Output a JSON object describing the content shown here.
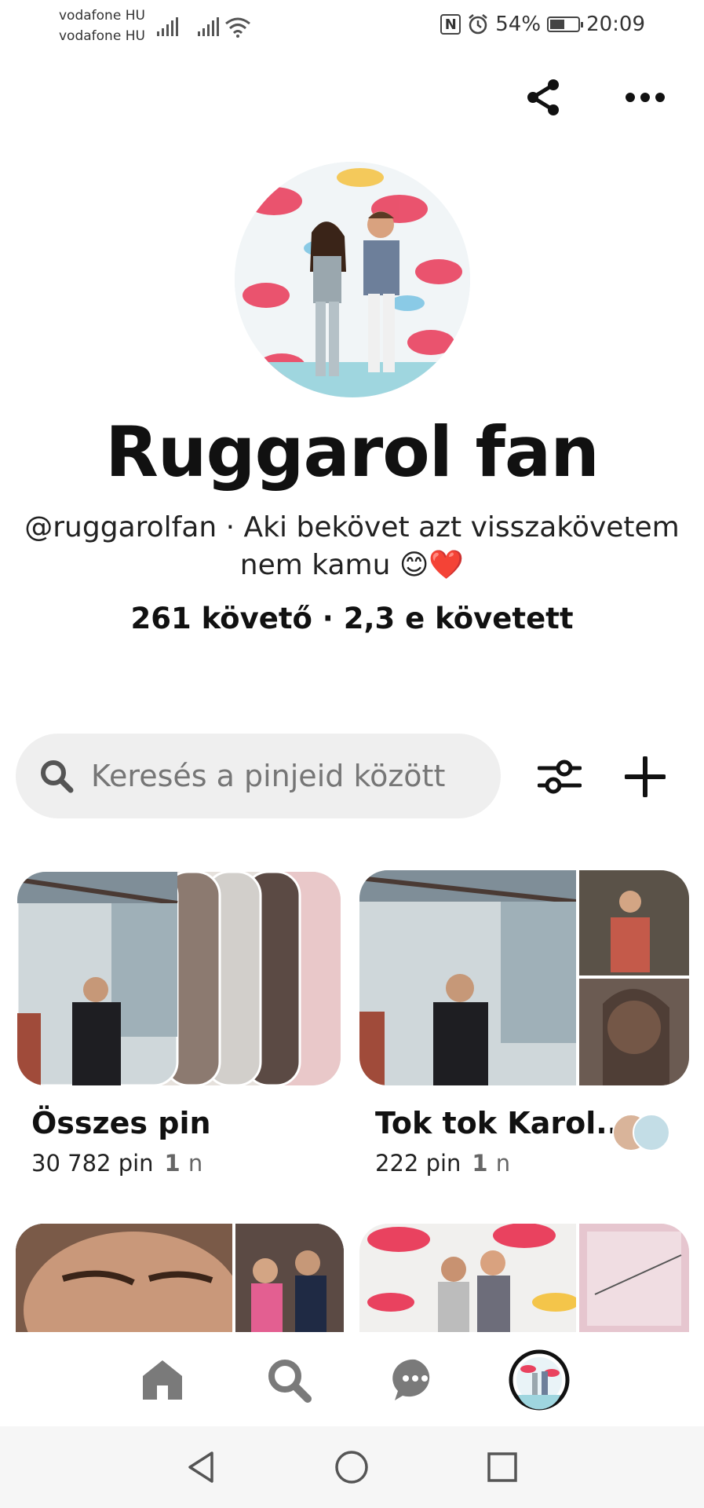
{
  "status_bar": {
    "carrier1": "vodafone HU",
    "carrier2": "vodafone HU",
    "nfc_label": "N",
    "battery_percent": "54%",
    "battery_level": 0.54,
    "time": "20:09"
  },
  "header": {
    "share_icon": "share-icon",
    "more_icon": "more-icon"
  },
  "profile": {
    "name": "Ruggarol fan",
    "bio_line1": "@ruggarolfan · Aki bekövet azt visszakövetem",
    "bio_line2": "nem kamu 😊❤️",
    "stats": "261 követő · 2,3 e követett"
  },
  "search": {
    "placeholder": "Keresés a pinjeid között"
  },
  "boards": [
    {
      "title": "Összes pin",
      "pins": "30 782 pin",
      "age_num": "1",
      "age_unit": "n"
    },
    {
      "title": "Tok tok Karol...",
      "pins": "222 pin",
      "age_num": "1",
      "age_unit": "n"
    }
  ],
  "bottom_nav": [
    "home-icon",
    "search-icon",
    "messages-icon",
    "profile-avatar"
  ],
  "colors": {
    "accent": "#111111",
    "search_bg": "#efefef",
    "gray_text": "#767676"
  }
}
